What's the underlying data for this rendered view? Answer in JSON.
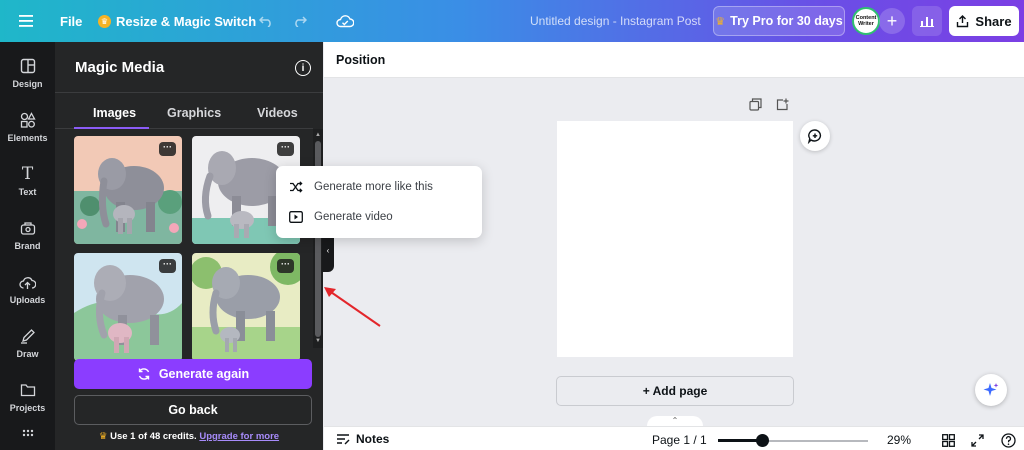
{
  "topbar": {
    "file_label": "File",
    "resize_label": "Resize & Magic Switch",
    "doc_title": "Untitled design - Instagram Post",
    "pro_label": "Try Pro for 30 days",
    "avatar_text": "Content Writer",
    "share_label": "Share"
  },
  "rail": {
    "items": [
      {
        "label": "Design",
        "icon": "design-icon"
      },
      {
        "label": "Elements",
        "icon": "elements-icon"
      },
      {
        "label": "Text",
        "icon": "text-icon"
      },
      {
        "label": "Brand",
        "icon": "brand-icon"
      },
      {
        "label": "Uploads",
        "icon": "uploads-icon"
      },
      {
        "label": "Draw",
        "icon": "draw-icon"
      },
      {
        "label": "Projects",
        "icon": "projects-icon"
      }
    ]
  },
  "panel": {
    "title": "Magic Media",
    "tabs": [
      {
        "label": "Images",
        "active": true
      },
      {
        "label": "Graphics",
        "active": false
      },
      {
        "label": "Videos",
        "active": false
      }
    ],
    "more_label": "···",
    "generate_again": "Generate again",
    "go_back": "Go back",
    "credits_text": "Use 1 of 48 credits.",
    "credits_link": "Upgrade for more"
  },
  "menu": {
    "items": [
      {
        "label": "Generate more like this",
        "icon": "shuffle-icon"
      },
      {
        "label": "Generate video",
        "icon": "video-play-icon"
      }
    ]
  },
  "workspace": {
    "position_label": "Position",
    "add_page": "+ Add page"
  },
  "footer": {
    "notes_label": "Notes",
    "page_indicator": "Page 1 / 1",
    "zoom_percent": "29%",
    "zoom_level": 0.29
  },
  "colors": {
    "accent": "#8b3dff",
    "panel_bg": "#252627",
    "rail_bg": "#18191b",
    "workspace_bg": "#ebecf0",
    "annotation_arrow": "#e3262b"
  }
}
